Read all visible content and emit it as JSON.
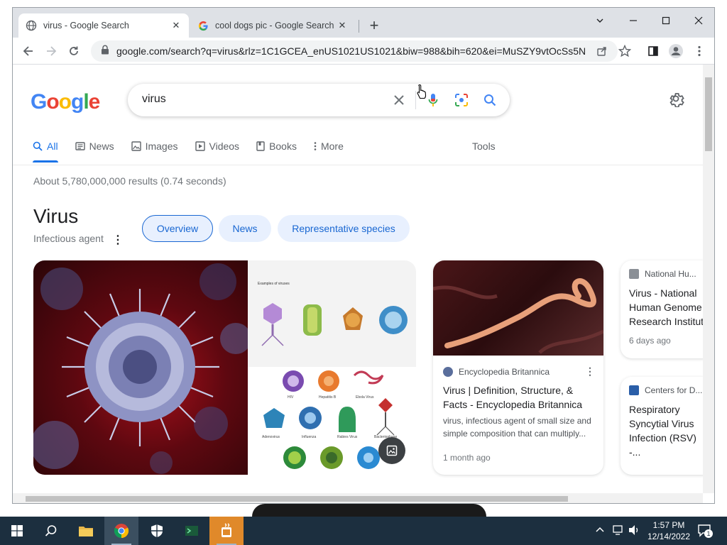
{
  "browser": {
    "tabs": [
      {
        "title": "virus - Google Search",
        "active": true
      },
      {
        "title": "cool dogs pic - Google Search",
        "active": false
      }
    ],
    "url": "google.com/search?q=virus&rlz=1C1GCEA_enUS1021US1021&biw=988&bih=620&ei=MuSZY9vtOcSs5N..."
  },
  "search": {
    "logo": "Google",
    "query": "virus"
  },
  "nav": {
    "items": [
      "All",
      "News",
      "Images",
      "Videos",
      "Books",
      "More"
    ],
    "tools": "Tools"
  },
  "result_stats": "About 5,780,000,000 results (0.74 seconds)",
  "knowledge_panel": {
    "title": "Virus",
    "subtitle": "Infectious agent",
    "chips": [
      "Overview",
      "News",
      "Representative species"
    ],
    "diagram_heading": "Examples of viruses",
    "grid_labels": [
      "HIV",
      "Hepatitis B",
      "Ebola Virus",
      "Adenovirus",
      "Influenza",
      "Rabies Virus",
      "Bacteriophage"
    ]
  },
  "cards": [
    {
      "source": "Encyclopedia Britannica",
      "title": "Virus | Definition, Structure, & Facts - Encyclopedia Britannica",
      "snippet": "virus, infectious agent of small size and simple composition that can multiply...",
      "date": "1 month ago"
    },
    {
      "source": "National Hu...",
      "title": "Virus - National Human Genome Research Institut",
      "date": "6 days ago"
    },
    {
      "source": "Centers for D...",
      "title": "Respiratory Syncytial Virus Infection (RSV) -..."
    }
  ],
  "taskbar": {
    "time": "1:57 PM",
    "date": "12/14/2022",
    "notification_count": "1"
  },
  "colors": {
    "accent": "#1a73e8",
    "chip_bg": "#e8f0fe",
    "taskbar": "#1c2f3f"
  }
}
